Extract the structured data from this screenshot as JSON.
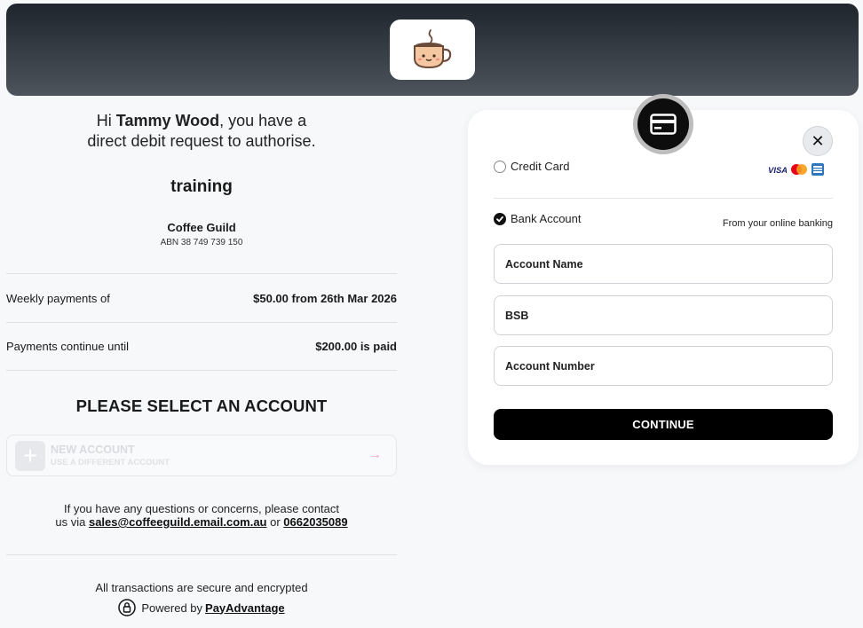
{
  "greeting": {
    "prefix": "Hi ",
    "name": "Tammy Wood",
    "line1_suffix": ", you have a",
    "line2": "direct debit request to authorise."
  },
  "reference": "training",
  "merchant": {
    "name": "Coffee Guild",
    "abn": "ABN 38 749 739 150"
  },
  "schedule": [
    {
      "label": "Weekly payments of",
      "value": "$50.00 from 26th Mar 2026"
    },
    {
      "label": "Payments continue until",
      "value": "$200.00 is paid"
    }
  ],
  "select_title": "PLEASE SELECT AN ACCOUNT",
  "new_account": {
    "title": "NEW ACCOUNT",
    "subtitle": "USE A DIFFERENT ACCOUNT",
    "arrow": "→"
  },
  "contact": {
    "line1": "If you have any questions or concerns, please contact",
    "prefix2": "us via ",
    "email": "sales@coffeeguild.email.com.au",
    "or": " or ",
    "phone": "0662035089"
  },
  "footer": {
    "secure": "All transactions are secure and encrypted",
    "powered_by": "Powered by",
    "brand": "PayAdvantage"
  },
  "payment_panel": {
    "close_symbol": "✕",
    "credit_card_label": "Credit Card",
    "credit_card_selected": false,
    "brands": [
      "VISA",
      "mastercard",
      "AMEX"
    ],
    "bank_account_label": "Bank Account",
    "bank_account_selected": true,
    "online_banking_note": "From your online banking",
    "fields": [
      {
        "placeholder": "Account Name"
      },
      {
        "placeholder": "BSB"
      },
      {
        "placeholder": "Account Number"
      }
    ],
    "continue_label": "CONTINUE"
  },
  "colors": {
    "header_top": "#1f252c",
    "header_bottom": "#4d545c",
    "accent": "#000000",
    "arrow": "#f2a5b5"
  }
}
